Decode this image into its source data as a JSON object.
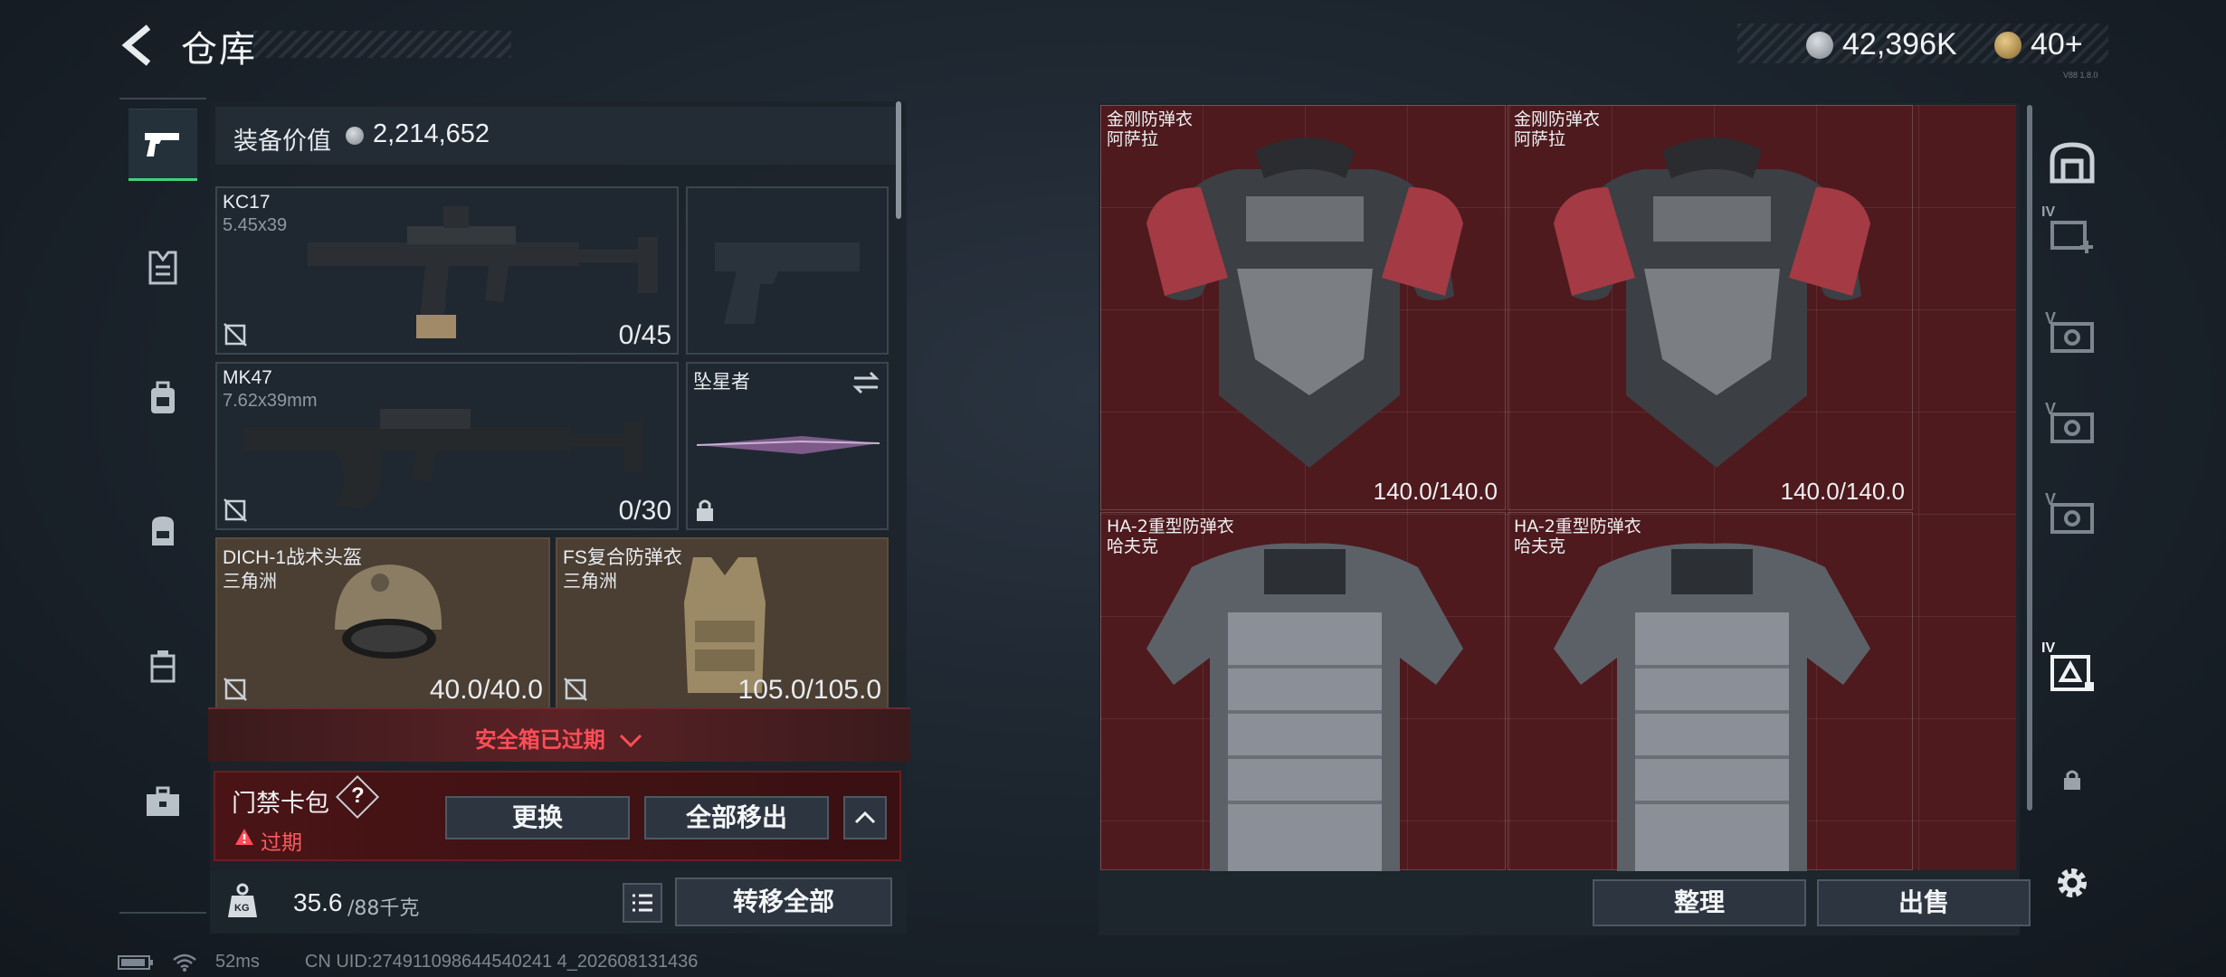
{
  "header": {
    "title": "仓库"
  },
  "currency": {
    "coins": "42,396K",
    "tickets": "40+"
  },
  "version_tag": "V88 1.8.0",
  "left_rail": [
    {
      "icon": "pistol-icon",
      "active": true
    },
    {
      "icon": "vest-icon",
      "active": false
    },
    {
      "icon": "backpack-small-icon",
      "active": false
    },
    {
      "icon": "backpack-icon",
      "active": false
    },
    {
      "icon": "case-icon",
      "active": false
    },
    {
      "icon": "toolbox-icon",
      "active": false
    }
  ],
  "equipment": {
    "value_label": "装备价值",
    "value": "2,214,652",
    "slots": {
      "primary": {
        "name": "KC17",
        "caliber": "5.45x39",
        "ammo": "0/45"
      },
      "secondary": {
        "name": "MK47",
        "caliber": "7.62x39mm",
        "ammo": "0/30"
      },
      "melee": {
        "name": "坠星者"
      },
      "helmet": {
        "name": "DICH-1战术头盔",
        "faction": "三角洲",
        "durability": "40.0/40.0"
      },
      "armor": {
        "name": "FS复合防弹衣",
        "faction": "三角洲",
        "durability": "105.0/105.0"
      }
    }
  },
  "safe_box": {
    "banner": "安全箱已过期"
  },
  "card_pack": {
    "title": "门禁卡包",
    "help": "?",
    "status": "过期",
    "replace": "更换",
    "remove_all": "全部移出"
  },
  "weight": {
    "current": "35.6",
    "max": "/88千克",
    "kg_label": "KG"
  },
  "transfer_all": "转移全部",
  "stash_items": [
    {
      "name": "金刚防弹衣",
      "sub": "阿萨拉",
      "durability": "140.0/140.0"
    },
    {
      "name": "金刚防弹衣",
      "sub": "阿萨拉",
      "durability": "140.0/140.0"
    },
    {
      "name": "HA-2重型防弹衣",
      "sub": "哈夫克",
      "durability": ""
    },
    {
      "name": "HA-2重型防弹衣",
      "sub": "哈夫克",
      "durability": ""
    }
  ],
  "stash_actions": {
    "sort": "整理",
    "sell": "出售"
  },
  "right_rail": [
    {
      "icon": "armor-stash-icon",
      "label": ""
    },
    {
      "icon": "add-stash-icon",
      "label": "IV"
    },
    {
      "icon": "stash-v-icon",
      "label": "V"
    },
    {
      "icon": "stash-v-icon",
      "label": "V"
    },
    {
      "icon": "stash-v-icon",
      "label": "V"
    },
    {
      "icon": "stash-iv-active-icon",
      "label": "IV"
    },
    {
      "icon": "lock-icon",
      "label": ""
    },
    {
      "icon": "gear-icon",
      "label": ""
    }
  ],
  "status": {
    "ping": "52ms",
    "uid": "CN UID:274911098644540241 4_202608131436"
  },
  "colors": {
    "accent_green": "#3fd17a",
    "alert_red": "#ff4d57",
    "stash_red": "#4e1a1e"
  }
}
